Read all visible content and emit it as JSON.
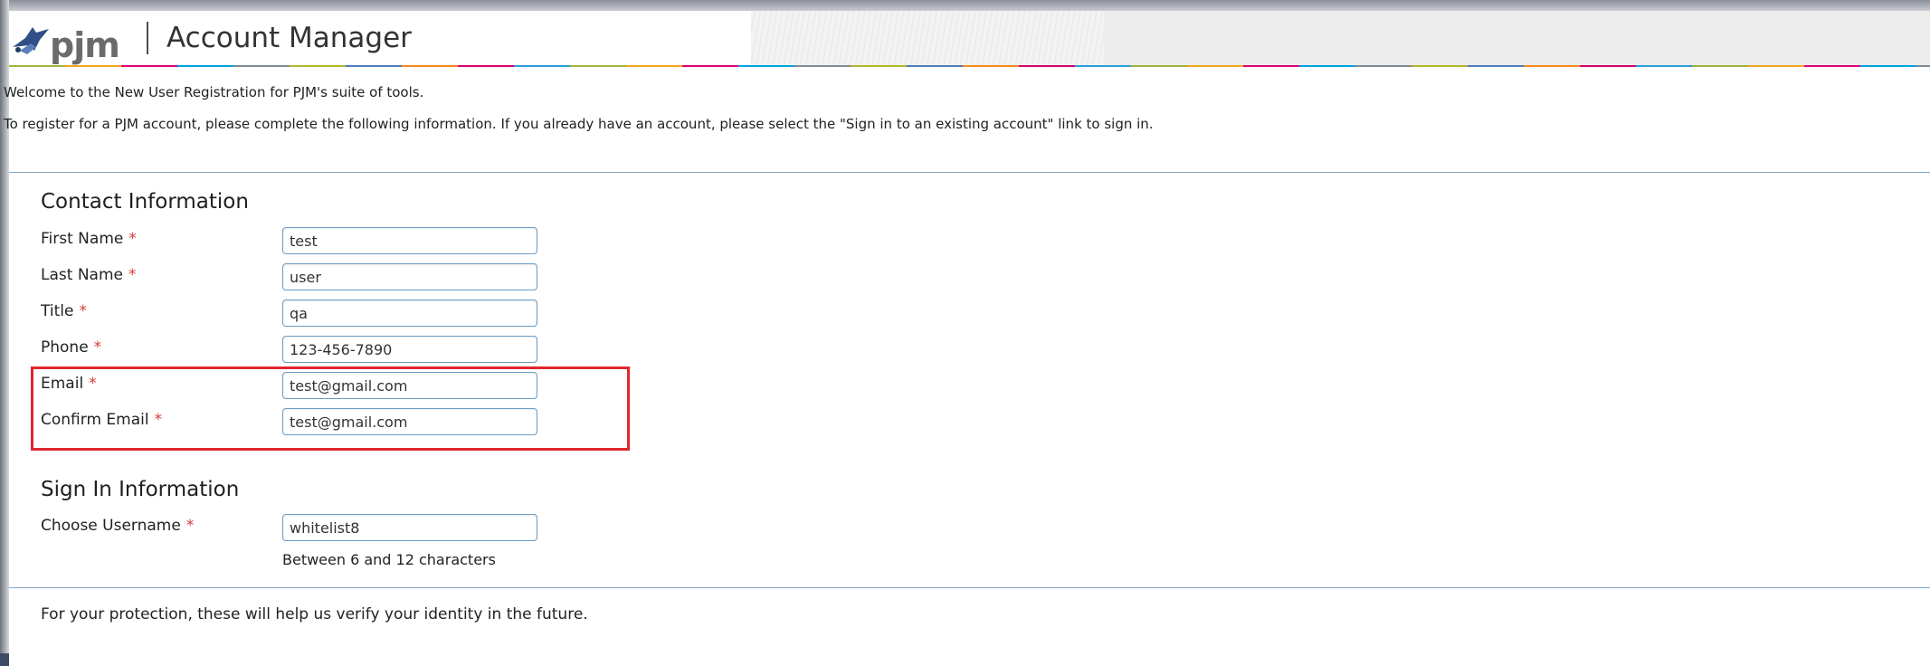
{
  "header": {
    "logo_text": "pjm",
    "app_title": "Account Manager",
    "stripe_colors": [
      "#9fb43a",
      "#f4a81d",
      "#e2007a",
      "#00a3e0",
      "#7f8b95",
      "#b0b82b",
      "#4c7dbd",
      "#f6891f",
      "#d6006f",
      "#2b9ed8"
    ]
  },
  "intro": {
    "welcome": "Welcome to the New User Registration for PJM's suite of tools.",
    "instructions": "To register for a PJM account, please complete the following information. If you already have an account, please select the \"Sign in to an existing account\" link to sign in."
  },
  "contact": {
    "title": "Contact Information",
    "required_marker": "*",
    "first_name": {
      "label": "First Name",
      "value": "test"
    },
    "last_name": {
      "label": "Last Name",
      "value": "user"
    },
    "title_field": {
      "label": "Title",
      "value": "qa"
    },
    "phone": {
      "label": "Phone",
      "value": "123-456-7890"
    },
    "email": {
      "label": "Email",
      "value": "test@gmail.com"
    },
    "confirm_email": {
      "label": "Confirm Email",
      "value": "test@gmail.com"
    }
  },
  "signin": {
    "title": "Sign In Information",
    "username": {
      "label": "Choose Username",
      "value": "whitelist8"
    },
    "username_hint": "Between 6 and 12 characters"
  },
  "security": {
    "note": "For your protection, these will help us verify your identity in the future."
  },
  "colors": {
    "accent_blue": "#6c9bc4",
    "required_red": "#d9363e",
    "highlight_red": "#e0262e"
  }
}
